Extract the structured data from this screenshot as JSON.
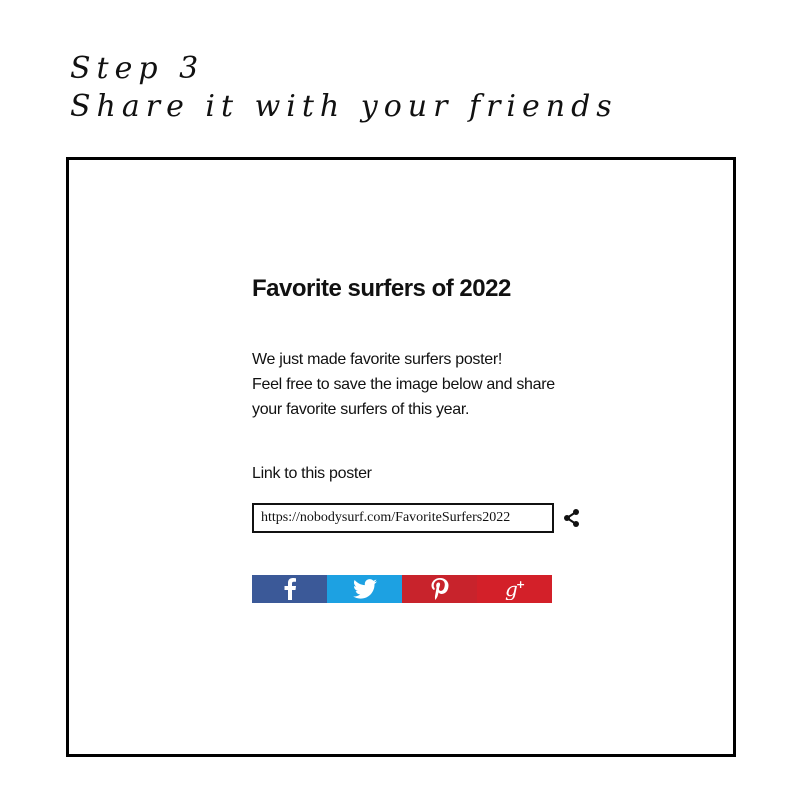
{
  "header": {
    "step": "Step 3",
    "instruction": "Share it with your friends"
  },
  "card": {
    "title": "Favorite surfers of 2022",
    "description": [
      "We just made favorite surfers poster!",
      "Feel free to save the image below and share",
      "your favorite surfers of this year."
    ],
    "link_label": "Link to this poster",
    "link_value": "https://nobodysurf.com/FavoriteSurfers2022",
    "share_icon": "share-icon"
  },
  "social": {
    "facebook": {
      "icon": "facebook-icon",
      "color": "#3B5998"
    },
    "twitter": {
      "icon": "twitter-icon",
      "color": "#1DA1E2"
    },
    "pinterest": {
      "icon": "pinterest-icon",
      "color": "#C8232C"
    },
    "googleplus": {
      "icon": "google-plus-icon",
      "color": "#D32029"
    }
  },
  "colors": {
    "frame_border": "#000000",
    "text": "#111111"
  }
}
